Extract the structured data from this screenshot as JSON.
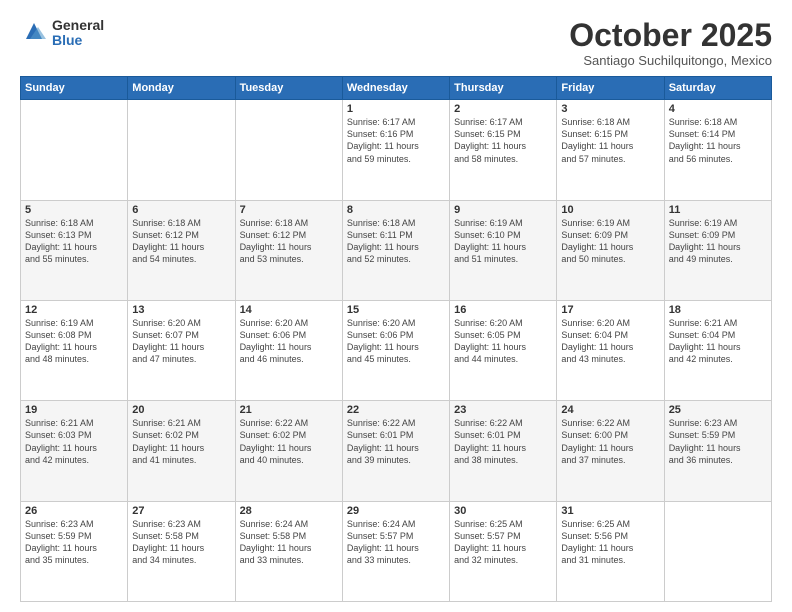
{
  "logo": {
    "general": "General",
    "blue": "Blue"
  },
  "header": {
    "month": "October 2025",
    "location": "Santiago Suchilquitongo, Mexico"
  },
  "weekdays": [
    "Sunday",
    "Monday",
    "Tuesday",
    "Wednesday",
    "Thursday",
    "Friday",
    "Saturday"
  ],
  "weeks": [
    [
      {
        "day": "",
        "info": ""
      },
      {
        "day": "",
        "info": ""
      },
      {
        "day": "",
        "info": ""
      },
      {
        "day": "1",
        "info": "Sunrise: 6:17 AM\nSunset: 6:16 PM\nDaylight: 11 hours\nand 59 minutes."
      },
      {
        "day": "2",
        "info": "Sunrise: 6:17 AM\nSunset: 6:15 PM\nDaylight: 11 hours\nand 58 minutes."
      },
      {
        "day": "3",
        "info": "Sunrise: 6:18 AM\nSunset: 6:15 PM\nDaylight: 11 hours\nand 57 minutes."
      },
      {
        "day": "4",
        "info": "Sunrise: 6:18 AM\nSunset: 6:14 PM\nDaylight: 11 hours\nand 56 minutes."
      }
    ],
    [
      {
        "day": "5",
        "info": "Sunrise: 6:18 AM\nSunset: 6:13 PM\nDaylight: 11 hours\nand 55 minutes."
      },
      {
        "day": "6",
        "info": "Sunrise: 6:18 AM\nSunset: 6:12 PM\nDaylight: 11 hours\nand 54 minutes."
      },
      {
        "day": "7",
        "info": "Sunrise: 6:18 AM\nSunset: 6:12 PM\nDaylight: 11 hours\nand 53 minutes."
      },
      {
        "day": "8",
        "info": "Sunrise: 6:18 AM\nSunset: 6:11 PM\nDaylight: 11 hours\nand 52 minutes."
      },
      {
        "day": "9",
        "info": "Sunrise: 6:19 AM\nSunset: 6:10 PM\nDaylight: 11 hours\nand 51 minutes."
      },
      {
        "day": "10",
        "info": "Sunrise: 6:19 AM\nSunset: 6:09 PM\nDaylight: 11 hours\nand 50 minutes."
      },
      {
        "day": "11",
        "info": "Sunrise: 6:19 AM\nSunset: 6:09 PM\nDaylight: 11 hours\nand 49 minutes."
      }
    ],
    [
      {
        "day": "12",
        "info": "Sunrise: 6:19 AM\nSunset: 6:08 PM\nDaylight: 11 hours\nand 48 minutes."
      },
      {
        "day": "13",
        "info": "Sunrise: 6:20 AM\nSunset: 6:07 PM\nDaylight: 11 hours\nand 47 minutes."
      },
      {
        "day": "14",
        "info": "Sunrise: 6:20 AM\nSunset: 6:06 PM\nDaylight: 11 hours\nand 46 minutes."
      },
      {
        "day": "15",
        "info": "Sunrise: 6:20 AM\nSunset: 6:06 PM\nDaylight: 11 hours\nand 45 minutes."
      },
      {
        "day": "16",
        "info": "Sunrise: 6:20 AM\nSunset: 6:05 PM\nDaylight: 11 hours\nand 44 minutes."
      },
      {
        "day": "17",
        "info": "Sunrise: 6:20 AM\nSunset: 6:04 PM\nDaylight: 11 hours\nand 43 minutes."
      },
      {
        "day": "18",
        "info": "Sunrise: 6:21 AM\nSunset: 6:04 PM\nDaylight: 11 hours\nand 42 minutes."
      }
    ],
    [
      {
        "day": "19",
        "info": "Sunrise: 6:21 AM\nSunset: 6:03 PM\nDaylight: 11 hours\nand 42 minutes."
      },
      {
        "day": "20",
        "info": "Sunrise: 6:21 AM\nSunset: 6:02 PM\nDaylight: 11 hours\nand 41 minutes."
      },
      {
        "day": "21",
        "info": "Sunrise: 6:22 AM\nSunset: 6:02 PM\nDaylight: 11 hours\nand 40 minutes."
      },
      {
        "day": "22",
        "info": "Sunrise: 6:22 AM\nSunset: 6:01 PM\nDaylight: 11 hours\nand 39 minutes."
      },
      {
        "day": "23",
        "info": "Sunrise: 6:22 AM\nSunset: 6:01 PM\nDaylight: 11 hours\nand 38 minutes."
      },
      {
        "day": "24",
        "info": "Sunrise: 6:22 AM\nSunset: 6:00 PM\nDaylight: 11 hours\nand 37 minutes."
      },
      {
        "day": "25",
        "info": "Sunrise: 6:23 AM\nSunset: 5:59 PM\nDaylight: 11 hours\nand 36 minutes."
      }
    ],
    [
      {
        "day": "26",
        "info": "Sunrise: 6:23 AM\nSunset: 5:59 PM\nDaylight: 11 hours\nand 35 minutes."
      },
      {
        "day": "27",
        "info": "Sunrise: 6:23 AM\nSunset: 5:58 PM\nDaylight: 11 hours\nand 34 minutes."
      },
      {
        "day": "28",
        "info": "Sunrise: 6:24 AM\nSunset: 5:58 PM\nDaylight: 11 hours\nand 33 minutes."
      },
      {
        "day": "29",
        "info": "Sunrise: 6:24 AM\nSunset: 5:57 PM\nDaylight: 11 hours\nand 33 minutes."
      },
      {
        "day": "30",
        "info": "Sunrise: 6:25 AM\nSunset: 5:57 PM\nDaylight: 11 hours\nand 32 minutes."
      },
      {
        "day": "31",
        "info": "Sunrise: 6:25 AM\nSunset: 5:56 PM\nDaylight: 11 hours\nand 31 minutes."
      },
      {
        "day": "",
        "info": ""
      }
    ]
  ]
}
